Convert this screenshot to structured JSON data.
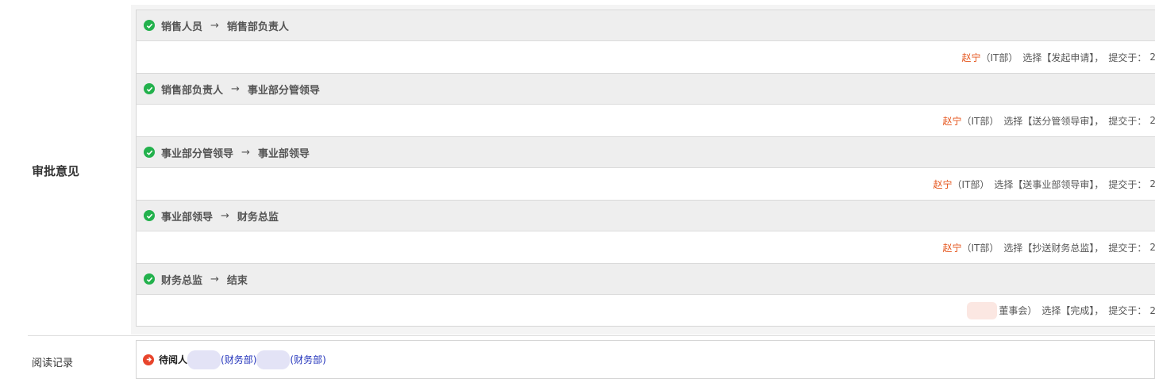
{
  "section_label": "审批意见",
  "steps": [
    {
      "from": "销售人员",
      "to": "销售部负责人",
      "actor": "赵宁",
      "dept": "（IT部）",
      "action": "选择【发起申请】，",
      "submit": "提交于：",
      "time": "2"
    },
    {
      "from": "销售部负责人",
      "to": "事业部分管领导",
      "actor": "赵宁",
      "dept": "（IT部）",
      "action": "选择【送分管领导审】，",
      "submit": "提交于：",
      "time": "2"
    },
    {
      "from": "事业部分管领导",
      "to": "事业部领导",
      "actor": "赵宁",
      "dept": "（IT部）",
      "action": "选择【送事业部领导审】，",
      "submit": "提交于：",
      "time": "2"
    },
    {
      "from": "事业部领导",
      "to": "财务总监",
      "actor": "赵宁",
      "dept": "（IT部）",
      "action": "选择【抄送财务总监】，",
      "submit": "提交于：",
      "time": "2"
    },
    {
      "from": "财务总监",
      "to": "结束",
      "actor": "",
      "dept": "董事会）",
      "action": "选择【完成】，",
      "submit": "提交于：",
      "time": "2"
    }
  ],
  "arrow": "→",
  "read_label": "阅读记录",
  "read": {
    "pending_label": "待阅人",
    "readers": [
      {
        "dept": "(财务部)"
      },
      {
        "dept": "(财务部)"
      }
    ]
  },
  "colors": {
    "check": "#22b14c",
    "actor": "#e5541b",
    "pending_icon": "#e8452c",
    "dept_link": "#2233bb"
  },
  "icons": {
    "step": "check-circle-icon",
    "pending": "arrow-circle-right-icon"
  }
}
